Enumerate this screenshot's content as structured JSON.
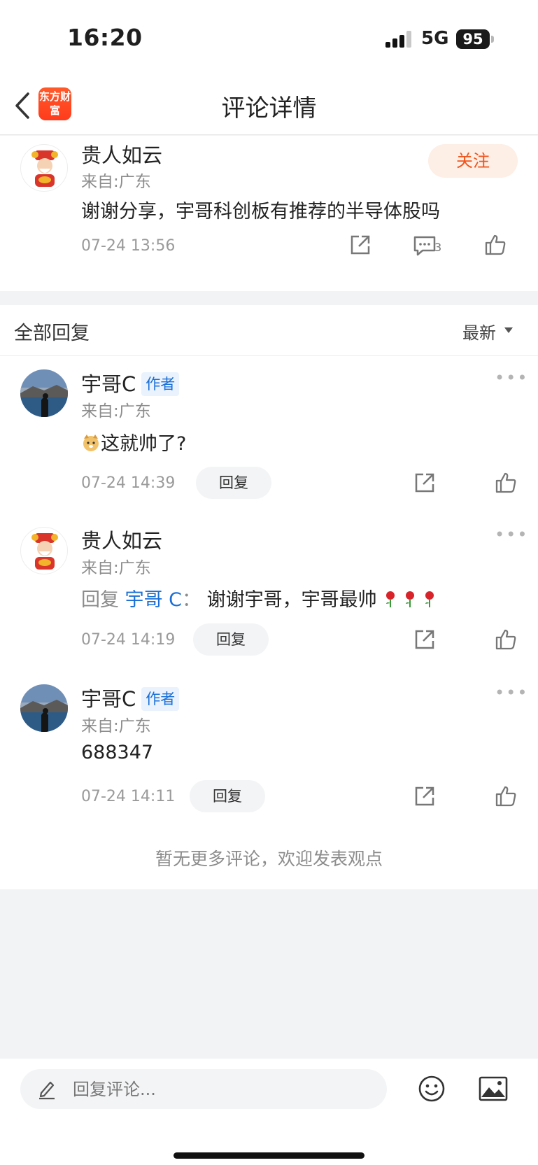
{
  "status_bar": {
    "time": "16:20",
    "network": "5G",
    "battery": "95"
  },
  "nav": {
    "title": "评论详情",
    "logo_text": "东方财富"
  },
  "main_comment": {
    "user": "贵人如云",
    "from": "来自:广东",
    "follow_label": "关注",
    "content": "谢谢分享，宇哥科创板有推荐的半导体股吗",
    "time": "07-24 13:56",
    "reply_count": "3"
  },
  "replies_header": {
    "title": "全部回复",
    "sort_label": "最新"
  },
  "replies": [
    {
      "user": "宇哥C",
      "author_tag": "作者",
      "from": "来自:广东",
      "content": "这就帅了?",
      "time": "07-24 14:39",
      "reply_label": "回复",
      "more": "•••"
    },
    {
      "user": "贵人如云",
      "from": "来自:广东",
      "reply_prefix": "回复",
      "reply_target": "宇哥 C",
      "reply_colon": "：",
      "content": "谢谢宇哥，宇哥最帅",
      "time": "07-24 14:19",
      "reply_label": "回复",
      "more": "•••"
    },
    {
      "user": "宇哥C",
      "author_tag": "作者",
      "from": "来自:广东",
      "content": "688347",
      "time": "07-24 14:11",
      "reply_label": "回复",
      "more": "•••"
    }
  ],
  "end_note": "暂无更多评论，欢迎发表观点",
  "bottom": {
    "placeholder": "回复评论..."
  },
  "colors": {
    "accent_orange": "#f1541c",
    "link_blue": "#1a6fd6",
    "logo_red": "#ff4a22"
  }
}
